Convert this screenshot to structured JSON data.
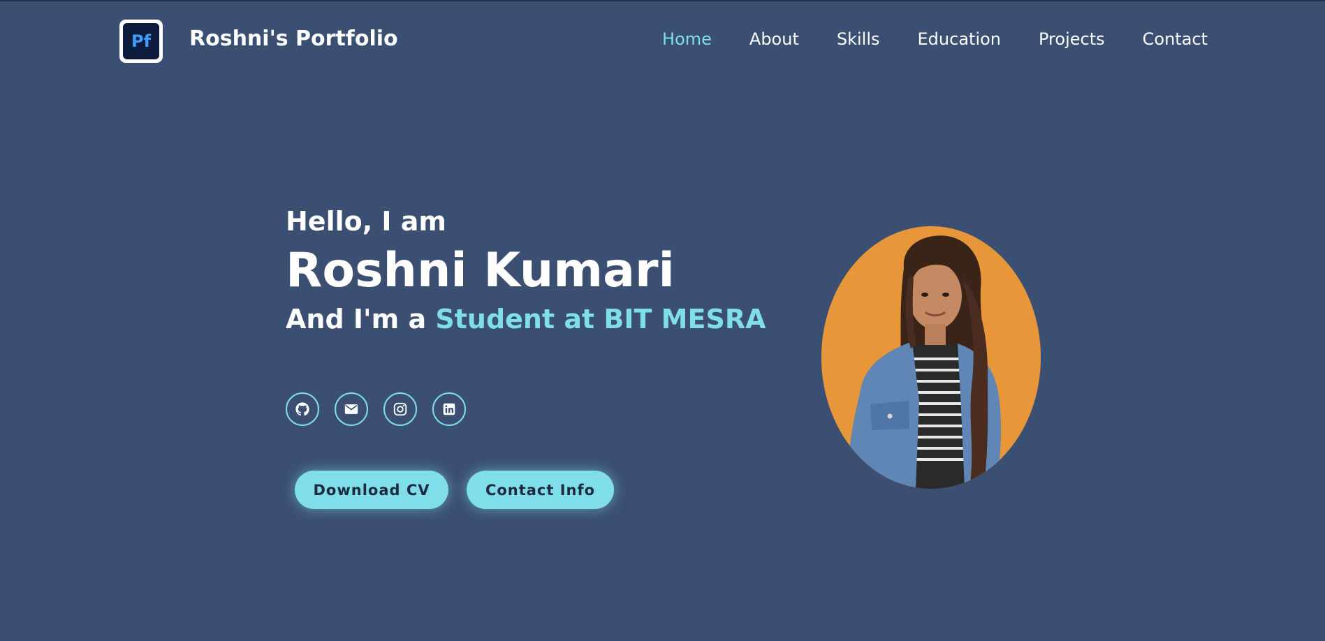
{
  "header": {
    "logo_text": "Pf",
    "brand": "Roshni's Portfolio",
    "nav": [
      {
        "label": "Home",
        "active": true
      },
      {
        "label": "About"
      },
      {
        "label": "Skills"
      },
      {
        "label": "Education"
      },
      {
        "label": "Projects"
      },
      {
        "label": "Contact"
      }
    ]
  },
  "hero": {
    "greeting": "Hello, I am",
    "name": "Roshni Kumari",
    "role_prefix": "And I'm a ",
    "role_highlight": "Student at BIT MESRA"
  },
  "socials": [
    {
      "icon": "github-icon"
    },
    {
      "icon": "email-icon"
    },
    {
      "icon": "instagram-icon"
    },
    {
      "icon": "linkedin-icon"
    }
  ],
  "buttons": {
    "download_cv": "Download CV",
    "contact_info": "Contact Info"
  },
  "colors": {
    "background": "#3b4f72",
    "accent": "#7fdeea",
    "photo_bg": "#e8963a",
    "logo_bg": "#0d1b3d",
    "logo_text": "#3fa0ff"
  }
}
